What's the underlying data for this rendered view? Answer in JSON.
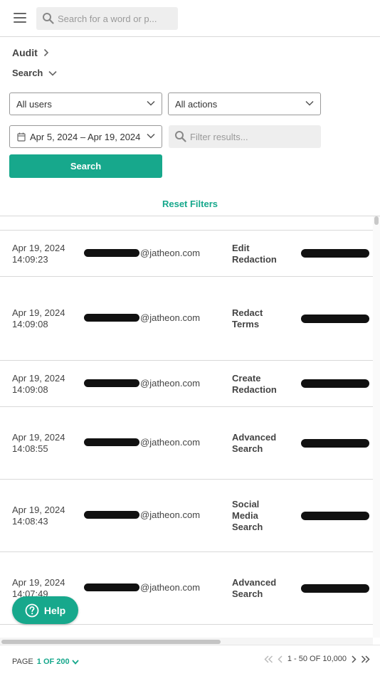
{
  "header": {
    "search_placeholder": "Search for a word or p..."
  },
  "breadcrumb": {
    "root": "Audit",
    "sub": "Search"
  },
  "filters": {
    "users_select": "All users",
    "actions_select": "All actions",
    "date_range": "Apr 5, 2024 – Apr 19, 2024",
    "filter_placeholder": "Filter results...",
    "search_button": "Search",
    "reset_link": "Reset Filters"
  },
  "table": {
    "rows": [
      {
        "date": "Apr 19, 2024",
        "time": "14:09:23",
        "user_domain": "@jatheon.com",
        "action_lines": [
          "Edit",
          "Redaction"
        ]
      },
      {
        "date": "Apr 19, 2024",
        "time": "14:09:08",
        "user_domain": "@jatheon.com",
        "action_lines": [
          "Redact",
          "Terms"
        ]
      },
      {
        "date": "Apr 19, 2024",
        "time": "14:09:08",
        "user_domain": "@jatheon.com",
        "action_lines": [
          "Create",
          "Redaction"
        ]
      },
      {
        "date": "Apr 19, 2024",
        "time": "14:08:55",
        "user_domain": "@jatheon.com",
        "action_lines": [
          "Advanced",
          "Search"
        ]
      },
      {
        "date": "Apr 19, 2024",
        "time": "14:08:43",
        "user_domain": "@jatheon.com",
        "action_lines": [
          "Social",
          "Media",
          "Search"
        ]
      },
      {
        "date": "Apr 19, 2024",
        "time": "14:07:49",
        "user_domain": "@jatheon.com",
        "action_lines": [
          "Advanced",
          "Search"
        ]
      }
    ]
  },
  "footer": {
    "page_label": "PAGE",
    "page_value": "1 OF 200",
    "range_text": "1 - 50 OF 10,000"
  },
  "help_button": "Help",
  "colors": {
    "accent": "#17a88c"
  }
}
